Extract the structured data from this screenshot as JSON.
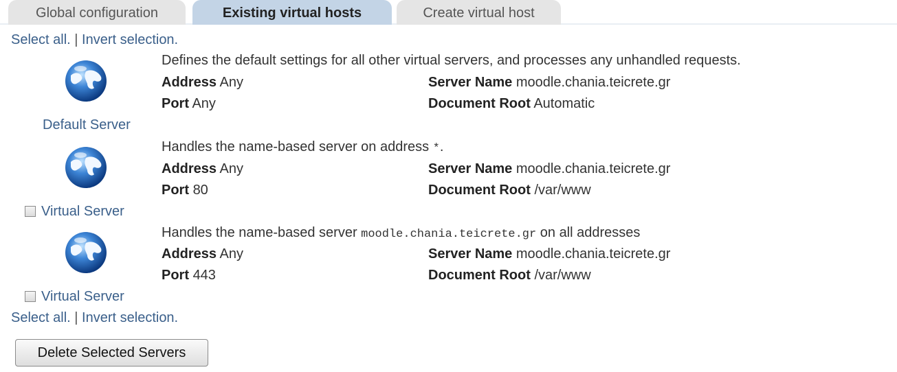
{
  "tabs": [
    {
      "label": "Global configuration"
    },
    {
      "label": "Existing virtual hosts"
    },
    {
      "label": "Create virtual host"
    }
  ],
  "selection": {
    "select_all": "Select all.",
    "separator": "|",
    "invert": "Invert selection."
  },
  "servers": [
    {
      "label": "Default Server",
      "description": "Defines the default settings for all other virtual servers, and processes any unhandled requests.",
      "address_label": "Address",
      "address": "Any",
      "port_label": "Port",
      "port": "Any",
      "server_name_label": "Server Name",
      "server_name": "moodle.chania.teicrete.gr",
      "doc_root_label": "Document Root",
      "doc_root": "Automatic"
    },
    {
      "label": "Virtual Server",
      "description_pre": "Handles the name-based server on address ",
      "description_code": "*",
      "description_post": ".",
      "address_label": "Address",
      "address": "Any",
      "port_label": "Port",
      "port": "80",
      "server_name_label": "Server Name",
      "server_name": "moodle.chania.teicrete.gr",
      "doc_root_label": "Document Root",
      "doc_root": "/var/www"
    },
    {
      "label": "Virtual Server",
      "description_pre": "Handles the name-based server ",
      "description_code": "moodle.chania.teicrete.gr",
      "description_post": " on all addresses",
      "address_label": "Address",
      "address": "Any",
      "port_label": "Port",
      "port": "443",
      "server_name_label": "Server Name",
      "server_name": "moodle.chania.teicrete.gr",
      "doc_root_label": "Document Root",
      "doc_root": "/var/www"
    }
  ],
  "delete_button": "Delete Selected Servers",
  "colors": {
    "active_tab": "#c3d4e6",
    "inactive_tab": "#e5e5e5",
    "link": "#3a5f8a",
    "globe": "#2f6db5"
  },
  "icons": {
    "server": "globe-icon"
  }
}
